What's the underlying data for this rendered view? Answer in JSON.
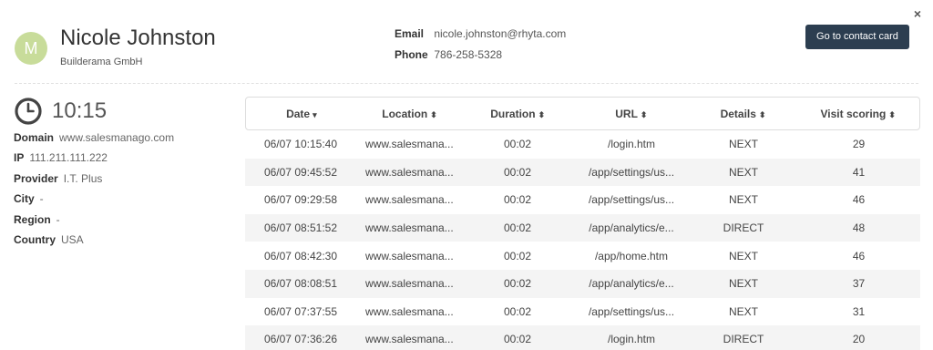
{
  "contact": {
    "initial": "M",
    "name": "Nicole Johnston",
    "company": "Builderama GmbH",
    "email_label": "Email",
    "email": "nicole.johnston@rhyta.com",
    "phone_label": "Phone",
    "phone": "786-258-5328",
    "cta_label": "Go to contact card",
    "close_glyph": "×"
  },
  "visit": {
    "time": "10:15",
    "fields": [
      {
        "label": "Domain",
        "value": "www.salesmanago.com"
      },
      {
        "label": "IP",
        "value": "111.211.111.222"
      },
      {
        "label": "Provider",
        "value": "I.T. Plus"
      },
      {
        "label": "City",
        "value": "-"
      },
      {
        "label": "Region",
        "value": "-"
      },
      {
        "label": "Country",
        "value": "USA"
      }
    ]
  },
  "table": {
    "headers": [
      {
        "label": "Date",
        "sort": "▾"
      },
      {
        "label": "Location",
        "sort": "⬍"
      },
      {
        "label": "Duration",
        "sort": "⬍"
      },
      {
        "label": "URL",
        "sort": "⬍"
      },
      {
        "label": "Details",
        "sort": "⬍"
      },
      {
        "label": "Visit scoring",
        "sort": "⬍"
      }
    ],
    "rows": [
      [
        "06/07 10:15:40",
        "www.salesmana...",
        "00:02",
        "/login.htm",
        "NEXT",
        "29"
      ],
      [
        "06/07 09:45:52",
        "www.salesmana...",
        "00:02",
        "/app/settings/us...",
        "NEXT",
        "41"
      ],
      [
        "06/07 09:29:58",
        "www.salesmana...",
        "00:02",
        "/app/settings/us...",
        "NEXT",
        "46"
      ],
      [
        "06/07 08:51:52",
        "www.salesmana...",
        "00:02",
        "/app/analytics/e...",
        "DIRECT",
        "48"
      ],
      [
        "06/07 08:42:30",
        "www.salesmana...",
        "00:02",
        "/app/home.htm",
        "NEXT",
        "46"
      ],
      [
        "06/07 08:08:51",
        "www.salesmana...",
        "00:02",
        "/app/analytics/e...",
        "NEXT",
        "37"
      ],
      [
        "06/07 07:37:55",
        "www.salesmana...",
        "00:02",
        "/app/settings/us...",
        "NEXT",
        "31"
      ],
      [
        "06/07 07:36:26",
        "www.salesmana...",
        "00:02",
        "/login.htm",
        "DIRECT",
        "20"
      ]
    ]
  },
  "colors": {
    "avatar_bg": "#c8dc9a",
    "cta_bg": "#2c3e50",
    "row_alt": "#f4f4f4"
  },
  "icons": {
    "clock": "clock-icon",
    "sort": "sort-icon",
    "close": "close-icon"
  }
}
